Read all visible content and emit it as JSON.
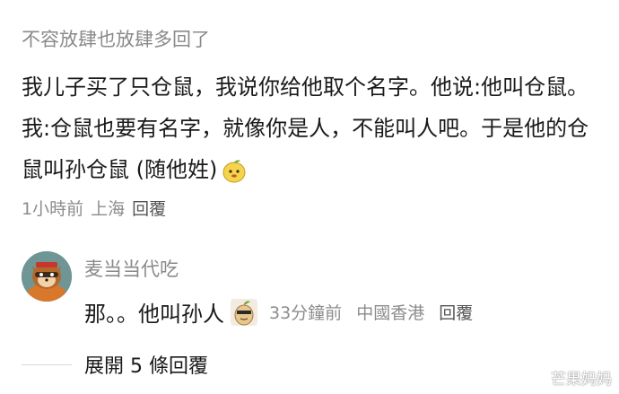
{
  "comment": {
    "username": "不容放肆也放肆多回了",
    "text": "我儿子买了只仓鼠，我说你给他取个名字。他说:他叫仓鼠。我:仓鼠也要有名字，就像你是人，不能叫人吧。于是他的仓鼠叫孙仓鼠 (随他姓)",
    "time": "1小時前",
    "location": "上海",
    "reply_label": "回覆",
    "emoji": "mango-emoji"
  },
  "reply": {
    "username": "麦当当代吃",
    "text": "那。。他叫孙人",
    "sticker": "mango-sticker",
    "time": "33分鐘前",
    "location": "中國香港",
    "reply_label": "回覆",
    "avatar": "raccoon-avatar"
  },
  "expand": {
    "label": "展開 5 條回覆"
  },
  "watermark": {
    "text": "芒果妈妈",
    "icon": "weibo-icon"
  }
}
